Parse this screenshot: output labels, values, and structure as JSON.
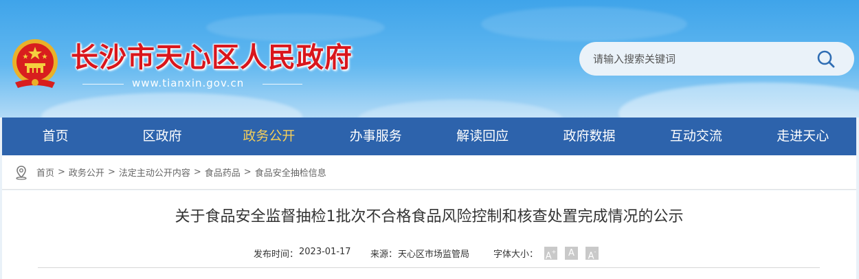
{
  "site": {
    "title": "长沙市天心区人民政府",
    "url": "www.tianxin.gov.cn"
  },
  "search": {
    "placeholder": "请输入搜索关键词",
    "icon": "search-icon"
  },
  "nav": {
    "items": [
      {
        "label": "首页"
      },
      {
        "label": "区政府"
      },
      {
        "label": "政务公开",
        "active": true
      },
      {
        "label": "办事服务"
      },
      {
        "label": "解读回应"
      },
      {
        "label": "政府数据"
      },
      {
        "label": "互动交流"
      },
      {
        "label": "走进天心"
      }
    ],
    "active_color": "#f5cf5a",
    "bg_color": "#2d63ac"
  },
  "breadcrumb": {
    "icon": "location-icon",
    "items": [
      "首页",
      "政务公开",
      "法定主动公开内容",
      "食品药品",
      "食品安全抽检信息"
    ],
    "separator": ">"
  },
  "article": {
    "title": "关于食品安全监督抽检1批次不合格食品风险控制和核查处置完成情况的公示",
    "publish_label": "发布时间：",
    "publish_date": "2023-01-17",
    "source_label": "来源：",
    "source": "天心区市场监管局",
    "font_size_label": "字体大小：",
    "font_buttons": [
      "A+",
      "A",
      "A-"
    ]
  },
  "colors": {
    "title_red": "#d9161c",
    "header_blue": "#3fa4ea"
  }
}
